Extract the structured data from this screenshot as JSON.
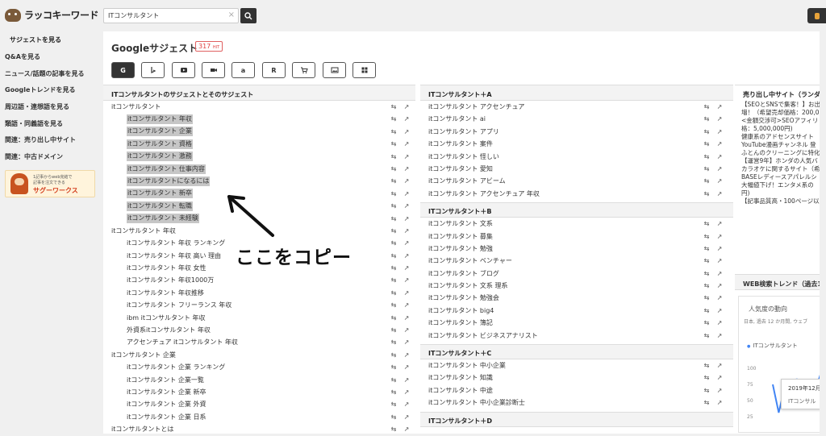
{
  "app": {
    "logo_text": "ラッコキーワード"
  },
  "search": {
    "value": "ITコンサルタント",
    "clear_glyph": "×"
  },
  "sidebar": {
    "heading": "サジェストを見る",
    "items": [
      {
        "label": "Q&Aを見る"
      },
      {
        "label": "ニュース/話題の記事を見る"
      },
      {
        "label": "Googleトレンドを見る"
      },
      {
        "label": "周辺語・連想語を見る"
      },
      {
        "label": "類語・同義語を見る"
      },
      {
        "label": "関連：売り出し中サイト"
      },
      {
        "label": "関連：中古ドメイン"
      }
    ],
    "ad": {
      "line1": "1記事からweb完結で",
      "line2": "記事を注文できる",
      "brand": "サグーワークス"
    }
  },
  "main": {
    "title": "Googleサジェスト",
    "hit_count": "317",
    "hit_unit": "HIT",
    "tools": [
      {
        "label": "G",
        "icon": "google-icon"
      },
      {
        "label": "",
        "icon": "bing-icon"
      },
      {
        "label": "",
        "icon": "youtube-icon"
      },
      {
        "label": "",
        "icon": "video-icon"
      },
      {
        "label": "a",
        "icon": "amazon-icon"
      },
      {
        "label": "R",
        "icon": "rakuten-icon"
      },
      {
        "label": "",
        "icon": "cart-icon"
      },
      {
        "label": "",
        "icon": "image-icon"
      },
      {
        "label": "",
        "icon": "grid-icon"
      }
    ]
  },
  "col1": {
    "heading": "ITコンサルタントのサジェストとそのサジェスト",
    "rows": [
      {
        "text": "itコンサルタント",
        "child": false,
        "hl": false
      },
      {
        "text": "itコンサルタント 年収",
        "child": true,
        "hl": true
      },
      {
        "text": "itコンサルタント 企業",
        "child": true,
        "hl": true
      },
      {
        "text": "itコンサルタント 資格",
        "child": true,
        "hl": true
      },
      {
        "text": "itコンサルタント 激務",
        "child": true,
        "hl": true
      },
      {
        "text": "itコンサルタント 仕事内容",
        "child": true,
        "hl": true
      },
      {
        "text": "itコンサルタントになるには",
        "child": true,
        "hl": true
      },
      {
        "text": "itコンサルタント 新卒",
        "child": true,
        "hl": true
      },
      {
        "text": "itコンサルタント 転職",
        "child": true,
        "hl": true
      },
      {
        "text": "itコンサルタント 未経験",
        "child": true,
        "hl": true
      },
      {
        "text": "itコンサルタント 年収",
        "child": false,
        "hl": false
      },
      {
        "text": "itコンサルタント 年収 ランキング",
        "child": true,
        "hl": false
      },
      {
        "text": "itコンサルタント 年収 高い 理由",
        "child": true,
        "hl": false
      },
      {
        "text": "itコンサルタント 年収 女性",
        "child": true,
        "hl": false
      },
      {
        "text": "itコンサルタント 年収1000万",
        "child": true,
        "hl": false
      },
      {
        "text": "itコンサルタント 年収推移",
        "child": true,
        "hl": false
      },
      {
        "text": "itコンサルタント フリーランス 年収",
        "child": true,
        "hl": false
      },
      {
        "text": "ibm itコンサルタント 年収",
        "child": true,
        "hl": false
      },
      {
        "text": "外資系itコンサルタント 年収",
        "child": true,
        "hl": false
      },
      {
        "text": "アクセンチュア itコンサルタント 年収",
        "child": true,
        "hl": false
      },
      {
        "text": "itコンサルタント 企業",
        "child": false,
        "hl": false
      },
      {
        "text": "itコンサルタント 企業 ランキング",
        "child": true,
        "hl": false
      },
      {
        "text": "itコンサルタント 企業一覧",
        "child": true,
        "hl": false
      },
      {
        "text": "itコンサルタント 企業 新卒",
        "child": true,
        "hl": false
      },
      {
        "text": "itコンサルタント 企業 外資",
        "child": true,
        "hl": false
      },
      {
        "text": "itコンサルタント 企業 日系",
        "child": true,
        "hl": false
      },
      {
        "text": "itコンサルタントとは",
        "child": false,
        "hl": false
      }
    ]
  },
  "col2": {
    "sections": [
      {
        "heading": "ITコンサルタント＋A",
        "rows": [
          "itコンサルタント アクセンチュア",
          "itコンサルタント ai",
          "itコンサルタント アプリ",
          "itコンサルタント 案件",
          "itコンサルタント 怪しい",
          "itコンサルタント 愛知",
          "itコンサルタント アビーム",
          "itコンサルタント アクセンチュア 年収"
        ]
      },
      {
        "heading": "ITコンサルタント＋B",
        "rows": [
          "itコンサルタント 文系",
          "itコンサルタント 募集",
          "itコンサルタント 勉強",
          "itコンサルタント ベンチャー",
          "itコンサルタント ブログ",
          "itコンサルタント 文系 理系",
          "itコンサルタント 勉強会",
          "itコンサルタント big4",
          "itコンサルタント 簿記",
          "itコンサルタント ビジネスアナリスト"
        ]
      },
      {
        "heading": "ITコンサルタント＋C",
        "rows": [
          "itコンサルタント 中小企業",
          "itコンサルタント 知識",
          "itコンサルタント 中途",
          "itコンサルタント 中小企業診断士"
        ]
      },
      {
        "heading": "ITコンサルタント＋D",
        "rows": []
      }
    ]
  },
  "col3": {
    "heading": "売り出し中サイト（ランダム）",
    "sale_items": [
      "【SEOとSNSで集客！】お出",
      "増！（希望売却価格：200,0",
      "<金額交渉可>SEOアフィリ",
      "格：5,000,000円)",
      "健康系のアドセンスサイト",
      "YouTube漫画チャンネル 登",
      "ふとんのクリーニングに特化",
      "【運営9年】ホンダの人気バ",
      "カラオケに関するサイト（希",
      "BASEレディースアパレルシ",
      "大幅値下げ！エンタメ系の",
      "円)",
      "【記事品質高・100ページ以"
    ],
    "trend": {
      "heading": "WEB検索トレンド（過去12",
      "card_title": "人気度の動向",
      "card_sub": "日本, 過去 12 か月間, ウェブ",
      "legend": "ITコンサルタント",
      "y_ticks": [
        "100",
        "75",
        "50",
        "25"
      ],
      "tooltip_date": "2019年12月",
      "tooltip_term": "ITコンサル"
    }
  },
  "annotation": {
    "text": "ここをコピー"
  },
  "colors": {
    "highlight": "#c6c6c6",
    "badge": "#e04040",
    "trend_line": "#4285f4"
  },
  "chart_data": {
    "type": "line",
    "title": "人気度の動向",
    "series": [
      {
        "name": "ITコンサルタント",
        "values": [
          70,
          20,
          65,
          30,
          80,
          40,
          72,
          55,
          90,
          50
        ]
      }
    ],
    "ylim": [
      0,
      100
    ]
  }
}
